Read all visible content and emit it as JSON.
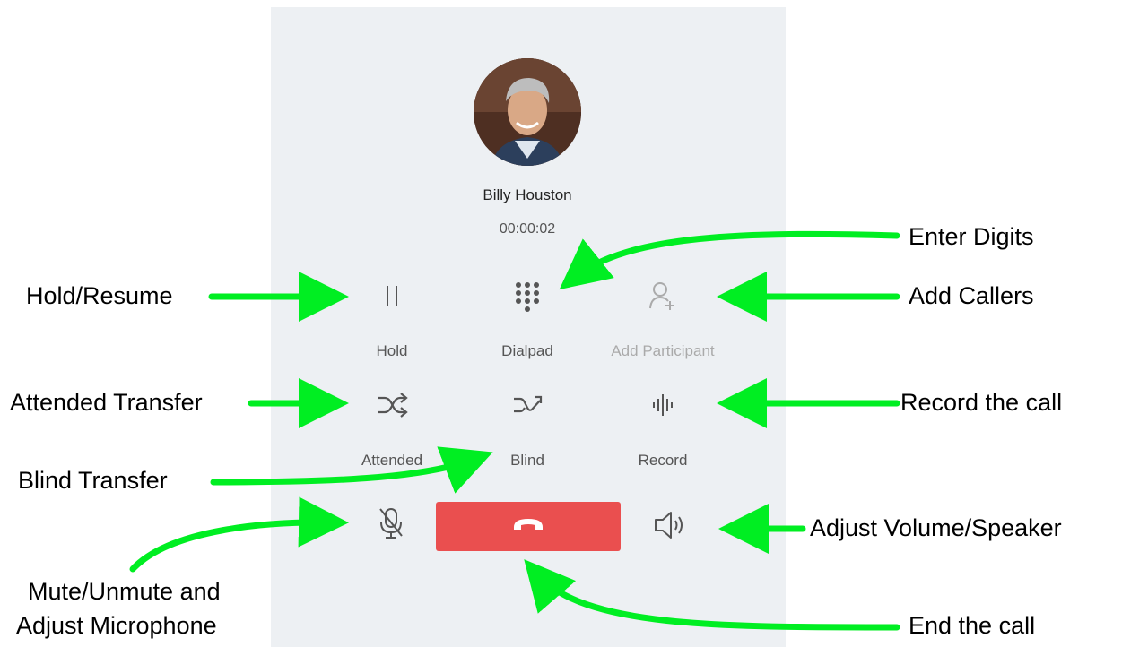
{
  "caller": {
    "name": "Billy Houston",
    "duration": "00:00:02"
  },
  "controls": {
    "hold": {
      "label": "Hold",
      "icon": "pause-icon"
    },
    "dialpad": {
      "label": "Dialpad",
      "icon": "dialpad-icon"
    },
    "add_participant": {
      "label": "Add Participant",
      "icon": "add-person-icon",
      "disabled": true
    },
    "attended": {
      "label": "Attended",
      "icon": "shuffle-icon"
    },
    "blind": {
      "label": "Blind",
      "icon": "blind-transfer-icon"
    },
    "record": {
      "label": "Record",
      "icon": "waveform-icon"
    }
  },
  "bottom_bar": {
    "mute_icon": "microphone-muted-icon",
    "end_icon": "hang-up-icon",
    "speaker_icon": "speaker-icon",
    "end_color": "#ea4f4f"
  },
  "annotations": {
    "enter_digits": "Enter Digits",
    "hold_resume": "Hold/Resume",
    "add_callers": "Add Callers",
    "attended_transfer": "Attended Transfer",
    "record_call": "Record the call",
    "blind_transfer": "Blind Transfer",
    "adjust_volume": "Adjust Volume/Speaker",
    "mute_line1": "Mute/Unmute and",
    "mute_line2": "Adjust Microphone",
    "end_call": "End the call"
  },
  "colors": {
    "arrow": "#00ee22",
    "background": "#edf0f3",
    "accent_red": "#ea4f4f"
  }
}
